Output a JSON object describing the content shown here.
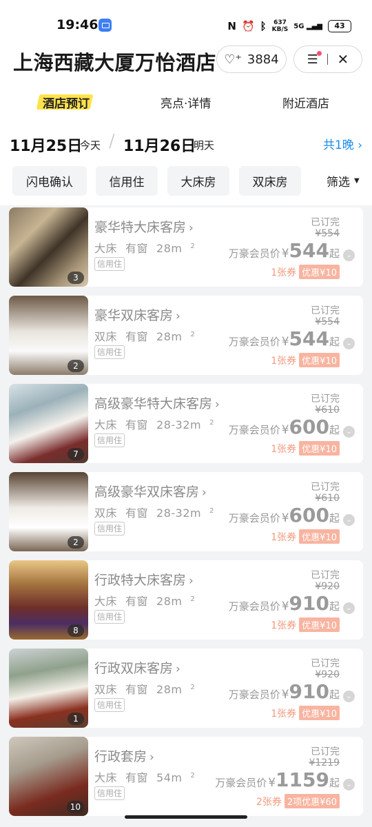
{
  "status_bar": {
    "time": "19:46",
    "nfc": "N",
    "speed_top": "637",
    "speed_bottom": "KB/S",
    "network": "5G",
    "battery": "43",
    "icons": [
      "message-app-icon",
      "nfc-icon",
      "alarm-icon",
      "bluetooth-icon",
      "signal-icon",
      "battery-icon"
    ]
  },
  "header": {
    "title": "上海西藏大厦万怡酒店",
    "fav_count": "3884"
  },
  "tabs": [
    {
      "label": "酒店预订",
      "active": true
    },
    {
      "label": "亮点·详情",
      "active": false
    },
    {
      "label": "附近酒店",
      "active": false
    }
  ],
  "dates": {
    "checkin": "11月25日",
    "checkin_label": "今天",
    "checkout": "11月26日",
    "checkout_label": "明天",
    "nights": "共1晚"
  },
  "filters": {
    "chips": [
      "闪电确认",
      "信用住",
      "大床房",
      "双床房"
    ],
    "more_label": "筛选"
  },
  "rooms": [
    {
      "name": "豪华特大床客房",
      "bed": "大床",
      "window": "有窗",
      "area": "28m",
      "tag": "信用住",
      "photo_count": "3",
      "status": "已订完",
      "original_price": "¥554",
      "member_label": "万豪会员价",
      "currency": "¥",
      "price": "544",
      "suffix": "起",
      "coupon_count": "1张券",
      "coupon_badge": "优惠¥10"
    },
    {
      "name": "豪华双床客房",
      "bed": "双床",
      "window": "有窗",
      "area": "28m",
      "tag": "信用住",
      "photo_count": "2",
      "status": "已订完",
      "original_price": "¥554",
      "member_label": "万豪会员价",
      "currency": "¥",
      "price": "544",
      "suffix": "起",
      "coupon_count": "1张券",
      "coupon_badge": "优惠¥10"
    },
    {
      "name": "高级豪华特大床客房",
      "bed": "大床",
      "window": "有窗",
      "area": "28-32m",
      "tag": "信用住",
      "photo_count": "7",
      "status": "已订完",
      "original_price": "¥610",
      "member_label": "万豪会员价",
      "currency": "¥",
      "price": "600",
      "suffix": "起",
      "coupon_count": "1张券",
      "coupon_badge": "优惠¥10"
    },
    {
      "name": "高级豪华双床客房",
      "bed": "双床",
      "window": "有窗",
      "area": "28-32m",
      "tag": "信用住",
      "photo_count": "2",
      "status": "已订完",
      "original_price": "¥610",
      "member_label": "万豪会员价",
      "currency": "¥",
      "price": "600",
      "suffix": "起",
      "coupon_count": "1张券",
      "coupon_badge": "优惠¥10"
    },
    {
      "name": "行政特大床客房",
      "bed": "大床",
      "window": "有窗",
      "area": "28m",
      "tag": "信用住",
      "photo_count": "8",
      "status": "已订完",
      "original_price": "¥920",
      "member_label": "万豪会员价",
      "currency": "¥",
      "price": "910",
      "suffix": "起",
      "coupon_count": "1张券",
      "coupon_badge": "优惠¥10"
    },
    {
      "name": "行政双床客房",
      "bed": "双床",
      "window": "有窗",
      "area": "28m",
      "tag": "信用住",
      "photo_count": "1",
      "status": "已订完",
      "original_price": "¥920",
      "member_label": "万豪会员价",
      "currency": "¥",
      "price": "910",
      "suffix": "起",
      "coupon_count": "1张券",
      "coupon_badge": "优惠¥10"
    },
    {
      "name": "行政套房",
      "bed": "大床",
      "window": "有窗",
      "area": "54m",
      "tag": "信用住",
      "photo_count": "10",
      "status": "已订完",
      "original_price": "¥1219",
      "member_label": "万豪会员价",
      "currency": "¥",
      "price": "1159",
      "suffix": "起",
      "coupon_count": "2张券",
      "coupon_badge": "2项优惠¥60"
    }
  ]
}
